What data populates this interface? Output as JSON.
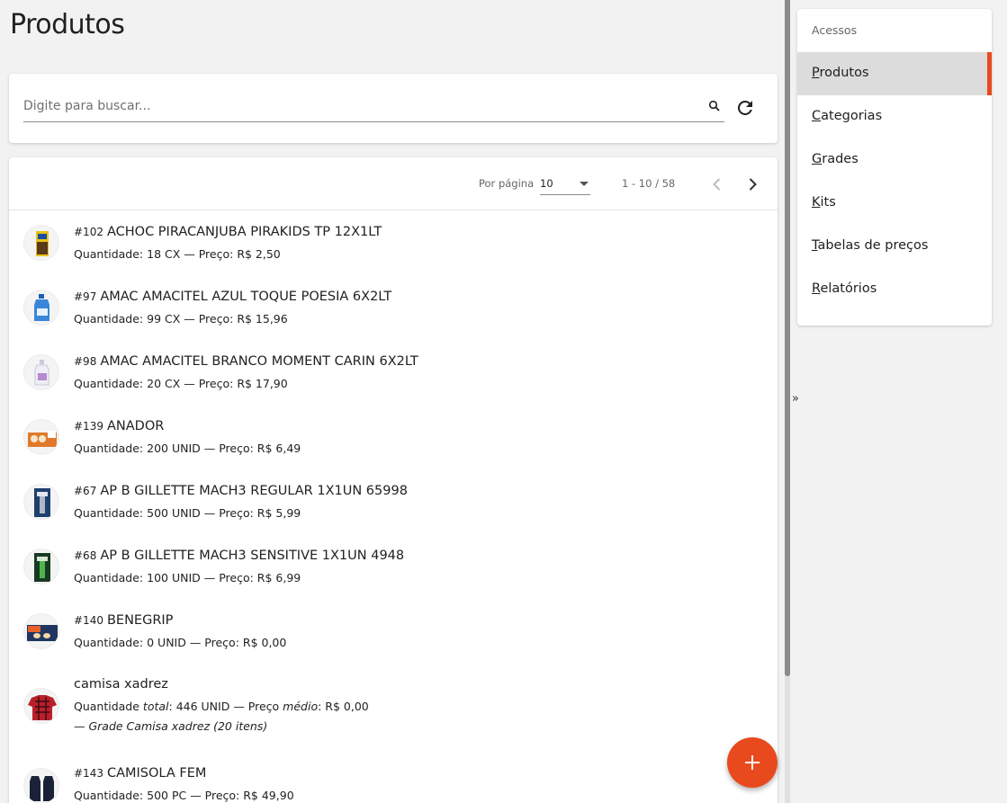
{
  "page": {
    "title": "Produtos"
  },
  "search": {
    "placeholder": "Digite para buscar...",
    "value": ""
  },
  "pagination": {
    "per_page_label": "Por página",
    "per_page_value": "10",
    "range": "1 - 10 / 58"
  },
  "products": [
    {
      "code": "#102",
      "name": "ACHOC PIRACANJUBA PIRAKIDS TP 12X1LT",
      "details": "Quantidade: 18 CX — Preço: R$ 2,50"
    },
    {
      "code": "#97",
      "name": "AMAC AMACITEL AZUL TOQUE POESIA 6X2LT",
      "details": "Quantidade: 99 CX — Preço: R$ 15,96"
    },
    {
      "code": "#98",
      "name": "AMAC AMACITEL BRANCO MOMENT CARIN 6X2LT",
      "details": "Quantidade: 20 CX — Preço: R$ 17,90"
    },
    {
      "code": "#139",
      "name": "ANADOR",
      "details": "Quantidade: 200 UNID — Preço: R$ 6,49"
    },
    {
      "code": "#67",
      "name": "AP B GILLETTE MACH3 REGULAR 1X1UN 65998",
      "details": "Quantidade: 500 UNID — Preço: R$ 5,99"
    },
    {
      "code": "#68",
      "name": "AP B GILLETTE MACH3 SENSITIVE 1X1UN 4948",
      "details": "Quantidade: 100 UNID — Preço: R$ 6,99"
    },
    {
      "code": "#140",
      "name": "BENEGRIP",
      "details": "Quantidade: 0 UNID — Preço: R$ 0,00"
    },
    {
      "code": "",
      "name": "camisa xadrez",
      "details_parts": [
        "Quantidade ",
        "total",
        ": 446 UNID — Preço ",
        "médio",
        ": R$ 0,00"
      ],
      "details2": "— Grade Camisa xadrez (20 itens)"
    },
    {
      "code": "#143",
      "name": "CAMISOLA FEM",
      "details": "Quantidade: 500 PC — Preço: R$ 49,90"
    }
  ],
  "sidebar": {
    "header": "Acessos",
    "items": [
      {
        "label": "Produtos",
        "active": true
      },
      {
        "label": "Categorias",
        "active": false
      },
      {
        "label": "Grades",
        "active": false
      },
      {
        "label": "Kits",
        "active": false
      },
      {
        "label": "Tabelas de preços",
        "active": false
      },
      {
        "label": "Relatórios",
        "active": false
      }
    ]
  },
  "toggle": {
    "label": "»"
  },
  "colors": {
    "accent": "#e84a1d",
    "active_bg": "#dcdcdc",
    "background": "#f2f2f2"
  },
  "icons": {
    "search": "search-icon",
    "refresh": "refresh-icon",
    "prev": "chevron-left-icon",
    "next": "chevron-right-icon",
    "add": "plus-icon"
  }
}
